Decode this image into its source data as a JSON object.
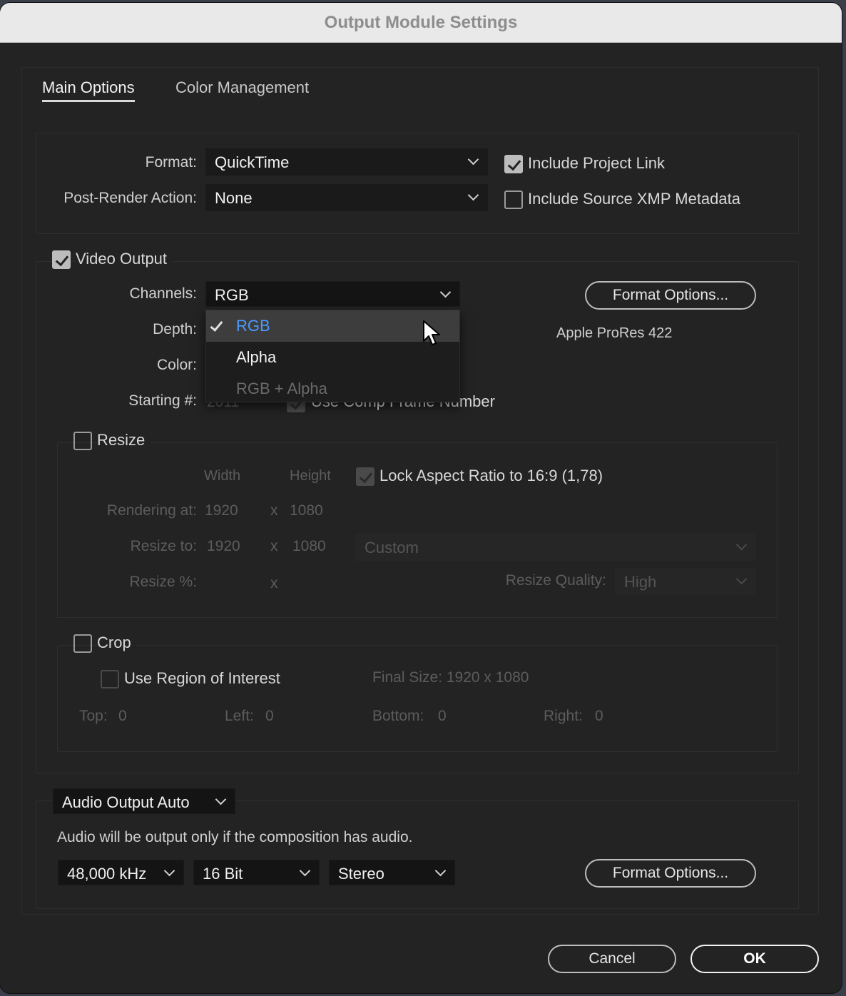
{
  "window": {
    "title": "Output Module Settings"
  },
  "tabs": [
    {
      "label": "Main Options",
      "active": true
    },
    {
      "label": "Color Management",
      "active": false
    }
  ],
  "top": {
    "format_label": "Format:",
    "format_value": "QuickTime",
    "post_render_label": "Post-Render Action:",
    "post_render_value": "None",
    "include_project_link": {
      "label": "Include Project Link",
      "checked": true
    },
    "include_xmp": {
      "label": "Include Source XMP Metadata",
      "checked": false
    }
  },
  "video": {
    "video_output": {
      "label": "Video Output",
      "checked": true
    },
    "channels_label": "Channels:",
    "channels_value": "RGB",
    "depth_label": "Depth:",
    "color_label": "Color:",
    "starting_label": "Starting #:",
    "starting_value": "2011",
    "use_comp_frame": "Use Comp Frame Number",
    "format_options_button": "Format Options...",
    "codec": "Apple ProRes 422",
    "channels_dropdown": {
      "options": [
        {
          "label": "RGB",
          "selected": true,
          "highlighted": true,
          "enabled": true
        },
        {
          "label": "Alpha",
          "selected": false,
          "highlighted": false,
          "enabled": true
        },
        {
          "label": "RGB + Alpha",
          "selected": false,
          "highlighted": false,
          "enabled": false
        }
      ]
    }
  },
  "resize": {
    "checkbox": {
      "label": "Resize",
      "checked": false
    },
    "width_header": "Width",
    "height_header": "Height",
    "lock_aspect": {
      "label": "Lock Aspect Ratio to 16:9 (1,78)",
      "checked": true
    },
    "rendering_at_label": "Rendering at:",
    "rendering_at_w": "1920",
    "rendering_at_h": "1080",
    "resize_to_label": "Resize to:",
    "resize_to_w": "1920",
    "resize_to_h": "1080",
    "preset": "Custom",
    "resize_pct_label": "Resize %:",
    "x": "x",
    "quality_label": "Resize Quality:",
    "quality_value": "High"
  },
  "crop": {
    "checkbox": {
      "label": "Crop",
      "checked": false
    },
    "use_roi": {
      "label": "Use Region of Interest",
      "checked": false
    },
    "final_size": "Final Size: 1920 x 1080",
    "top_label": "Top:",
    "top_value": "0",
    "left_label": "Left:",
    "left_value": "0",
    "bottom_label": "Bottom:",
    "bottom_value": "0",
    "right_label": "Right:",
    "right_value": "0"
  },
  "audio": {
    "mode": "Audio Output Auto",
    "note": "Audio will be output only if the composition has audio.",
    "rate": "48,000 kHz",
    "depth": "16 Bit",
    "channels": "Stereo",
    "format_options_button": "Format Options..."
  },
  "footer": {
    "cancel": "Cancel",
    "ok": "OK"
  }
}
